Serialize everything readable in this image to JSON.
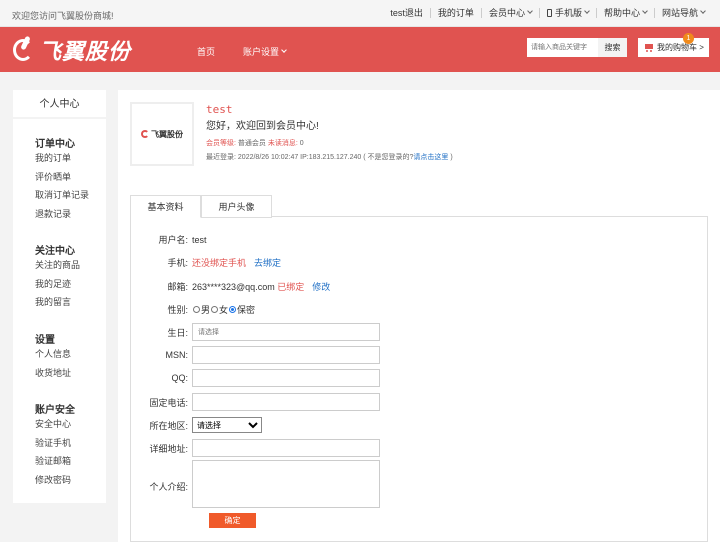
{
  "topbar": {
    "welcome": "欢迎您访问飞翼股份商城!",
    "links": [
      "test退出",
      "我的订单",
      "会员中心",
      "手机版",
      "帮助中心",
      "网站导航"
    ]
  },
  "header": {
    "logo_text": "飞翼股份",
    "nav": [
      "首页",
      "账户设置"
    ],
    "search_placeholder": "请输入商品关键字",
    "search_button": "搜索",
    "cart_label": "我的购物车 >",
    "cart_count": "1"
  },
  "sidebar": {
    "title": "个人中心",
    "groups": [
      {
        "head": "订单中心",
        "items": [
          "我的订单",
          "评价晒单",
          "取消订单记录",
          "退款记录"
        ]
      },
      {
        "head": "关注中心",
        "items": [
          "关注的商品",
          "我的足迹",
          "我的留言"
        ]
      },
      {
        "head": "设置",
        "items": [
          "个人信息",
          "收货地址"
        ]
      },
      {
        "head": "账户安全",
        "items": [
          "安全中心",
          "验证手机",
          "验证邮箱",
          "修改密码"
        ]
      }
    ]
  },
  "profile": {
    "avatar_logo": "飞翼股份",
    "username": "test",
    "greeting": "您好，欢迎回到会员中心!",
    "level_label": "会员等级:",
    "level_value": "普通会员",
    "unread_label": "未读消息:",
    "unread_value": "0",
    "last_login_label": "最近登录:",
    "last_login_value": "2022/8/26 10:02:47 IP:183.215.127.240",
    "not_me": "( 不是您登录的?",
    "click_here": "请点击这里",
    "close_paren": ")"
  },
  "tabs": [
    "基本资料",
    "用户头像"
  ],
  "form": {
    "username_label": "用户名:",
    "username_value": "test",
    "phone_label": "手机:",
    "phone_status": "还没绑定手机",
    "phone_action": "去绑定",
    "email_label": "邮箱:",
    "email_value": "263****323@qq.com",
    "email_status": "已绑定",
    "email_action": "修改",
    "gender_label": "性别:",
    "gender_options": [
      "男",
      "女",
      "保密"
    ],
    "birthday_label": "生日:",
    "birthday_placeholder": "请选择",
    "msn_label": "MSN:",
    "qq_label": "QQ:",
    "tel_label": "固定电话:",
    "region_label": "所在地区:",
    "region_value": "请选择",
    "address_label": "详细地址:",
    "intro_label": "个人介绍:",
    "submit": "确定"
  }
}
